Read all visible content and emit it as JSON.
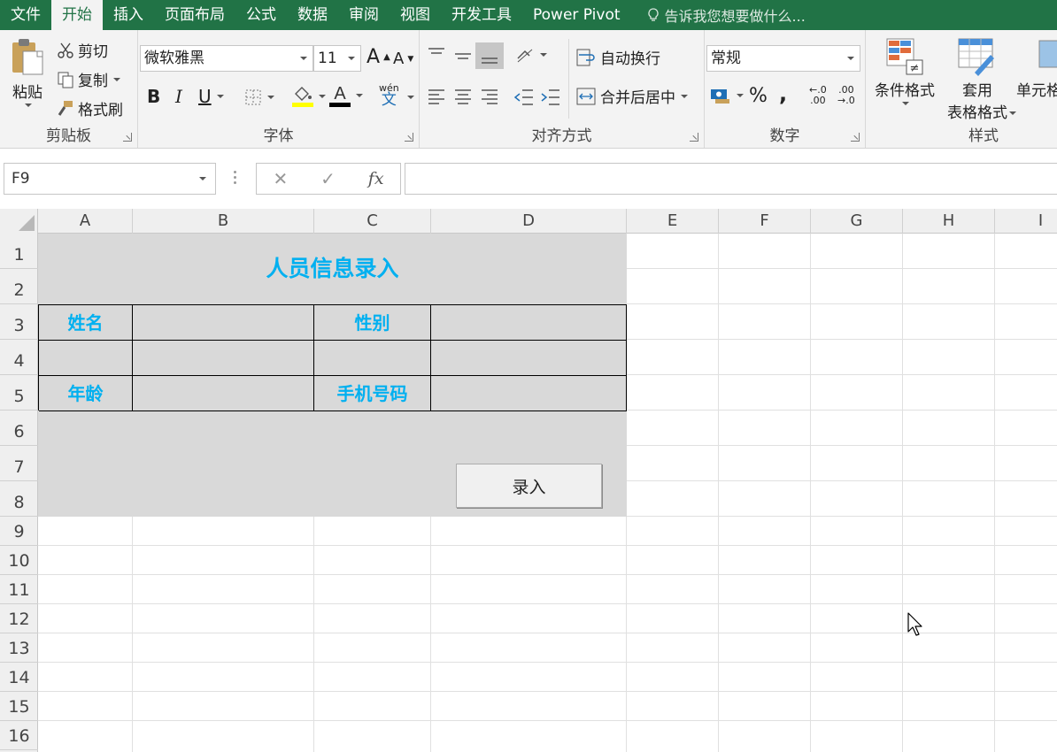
{
  "menu": {
    "tabs": [
      "文件",
      "开始",
      "插入",
      "页面布局",
      "公式",
      "数据",
      "审阅",
      "视图",
      "开发工具",
      "Power Pivot"
    ],
    "active_tab": "开始",
    "tell_me": "告诉我您想要做什么..."
  },
  "ribbon": {
    "clipboard": {
      "paste": "粘贴",
      "cut": "剪切",
      "copy": "复制",
      "format_painter": "格式刷",
      "label": "剪贴板"
    },
    "font": {
      "name": "微软雅黑",
      "size": "11",
      "grow": "A",
      "shrink": "A",
      "bold": "B",
      "italic": "I",
      "underline": "U",
      "phonetic_top": "wén",
      "phonetic_bottom": "文",
      "label": "字体"
    },
    "alignment": {
      "wrap": "自动换行",
      "merge": "合并后居中",
      "label": "对齐方式"
    },
    "number": {
      "format": "常规",
      "percent": "%",
      "comma": ",",
      "inc_top": "←.0",
      "inc_bottom": ".00",
      "dec_top": ".00",
      "dec_bottom": "→.0",
      "label": "数字"
    },
    "styles": {
      "conditional": "条件格式",
      "table_top": "套用",
      "table_bottom": "表格格式",
      "cell": "单元格",
      "label": "样式"
    }
  },
  "formula_bar": {
    "name_box": "F9",
    "cancel": "✕",
    "enter": "✓",
    "fx": "fx",
    "value": ""
  },
  "sheet": {
    "columns": [
      "A",
      "B",
      "C",
      "D",
      "E",
      "F",
      "G",
      "H",
      "I"
    ],
    "rows": [
      "1",
      "2",
      "3",
      "4",
      "5",
      "6",
      "7",
      "8",
      "9",
      "10",
      "11",
      "12",
      "13",
      "14",
      "15",
      "16"
    ],
    "form": {
      "title": "人员信息录入",
      "name_label": "姓名",
      "gender_label": "性别",
      "age_label": "年龄",
      "phone_label": "手机号码",
      "submit": "录入"
    }
  },
  "colors": {
    "menu_bg": "#217346",
    "form_bg": "#d9d9d9",
    "label_text": "#00b0f0"
  }
}
